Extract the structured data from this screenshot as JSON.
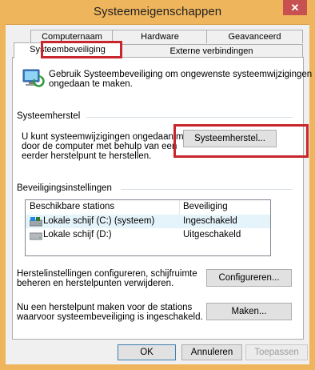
{
  "window": {
    "title": "Systeemeigenschappen",
    "close_glyph": "✕"
  },
  "tabs": {
    "row1": [
      "Computernaam",
      "Hardware",
      "Geavanceerd"
    ],
    "row2": [
      "Systeembeveiliging",
      "Externe verbindingen"
    ],
    "selected": "Systeembeveiliging"
  },
  "intro": {
    "text_line1": "Gebruik Systeembeveiliging om ongewenste systeemwijzigingen",
    "text_line2": "ongedaan te maken."
  },
  "restore": {
    "section_label": "Systeemherstel",
    "desc_line1": "U kunt systeemwijzigingen ongedaan maken",
    "desc_line2": "door de computer met behulp van een",
    "desc_line3": "eerder herstelpunt te herstellen.",
    "button": "Systeemherstel..."
  },
  "protection": {
    "section_label": "Beveiligingsinstellingen",
    "columns": [
      "Beschikbare stations",
      "Beveiliging"
    ],
    "rows": [
      {
        "drive": "Lokale schijf (C:) (systeem)",
        "status": "Ingeschakeld",
        "icon": "system-drive-icon"
      },
      {
        "drive": "Lokale schijf (D:)",
        "status": "Uitgeschakeld",
        "icon": "drive-icon"
      }
    ]
  },
  "configure": {
    "desc_line1": "Herstelinstellingen configureren, schijfruimte",
    "desc_line2": "beheren en herstelpunten verwijderen.",
    "button": "Configureren..."
  },
  "create": {
    "desc_line1": "Nu een herstelpunt maken voor de stations",
    "desc_line2": "waarvoor systeembeveiliging is ingeschakeld.",
    "button": "Maken..."
  },
  "footer": {
    "ok": "OK",
    "cancel": "Annuleren",
    "apply": "Toepassen"
  },
  "colors": {
    "titlebar": "#efb55c",
    "close": "#c75050",
    "highlight": "#c8262c"
  }
}
